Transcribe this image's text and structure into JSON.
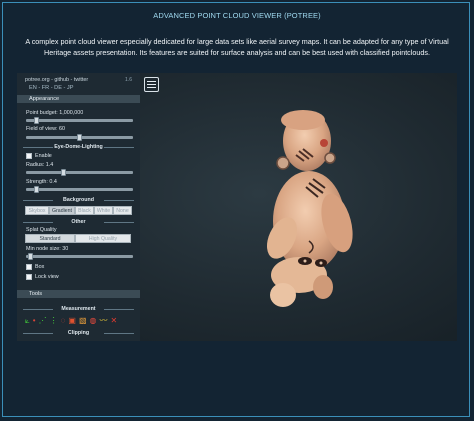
{
  "page": {
    "title": "ADVANCED POINT CLOUD VIEWER (POTREE)",
    "description": "A complex point cloud viewer especially dedicated for large data sets like aerial survey maps. It can be adapted for any type of Virtual Heritage assets presentation. Its features are suited for surface analysis and can be best used with classified pointclouds."
  },
  "viewer": {
    "menu_icon": "hamburger-menu-icon"
  },
  "sidebar": {
    "links": "potree.org - github - twitter",
    "version": "1.6",
    "languages": "EN - FR - DE - JP",
    "appearance": {
      "header": "Appearance",
      "point_budget_label": "Point budget: 1,000,000",
      "point_budget_fraction": 0.08,
      "fov_label": "Field of view: 60",
      "fov_fraction": 0.5
    },
    "edl": {
      "header": "Eye-Dome-Lighting",
      "enable_label": "Enable",
      "radius_label": "Radius: 1.4",
      "radius_fraction": 0.34,
      "strength_label": "Strength: 0.4",
      "strength_fraction": 0.08
    },
    "background": {
      "header": "Background",
      "options": [
        "Skybox",
        "Gradient",
        "Black",
        "White",
        "None"
      ],
      "selected": "Gradient"
    },
    "other": {
      "header": "Other",
      "splat_label": "Splat Quality",
      "splat_options": [
        "Standard",
        "High Quality"
      ],
      "splat_selected": "Standard",
      "min_node_label": "Min node size: 30",
      "min_node_fraction": 0.02,
      "box_label": "Box",
      "lock_view_label": "Lock view"
    },
    "tools": {
      "header": "Tools",
      "measurement_label": "Measurement",
      "measurement_icons": [
        "angle-icon",
        "point-icon",
        "distance-icon",
        "height-icon",
        "circle-icon",
        "area-icon",
        "volume-icon",
        "sphere-volume-icon",
        "profile-icon",
        "remove-all-icon"
      ],
      "clipping_label": "Clipping"
    }
  },
  "colors": {
    "accent": "#3b8fb9",
    "title": "#9fd8ef"
  }
}
